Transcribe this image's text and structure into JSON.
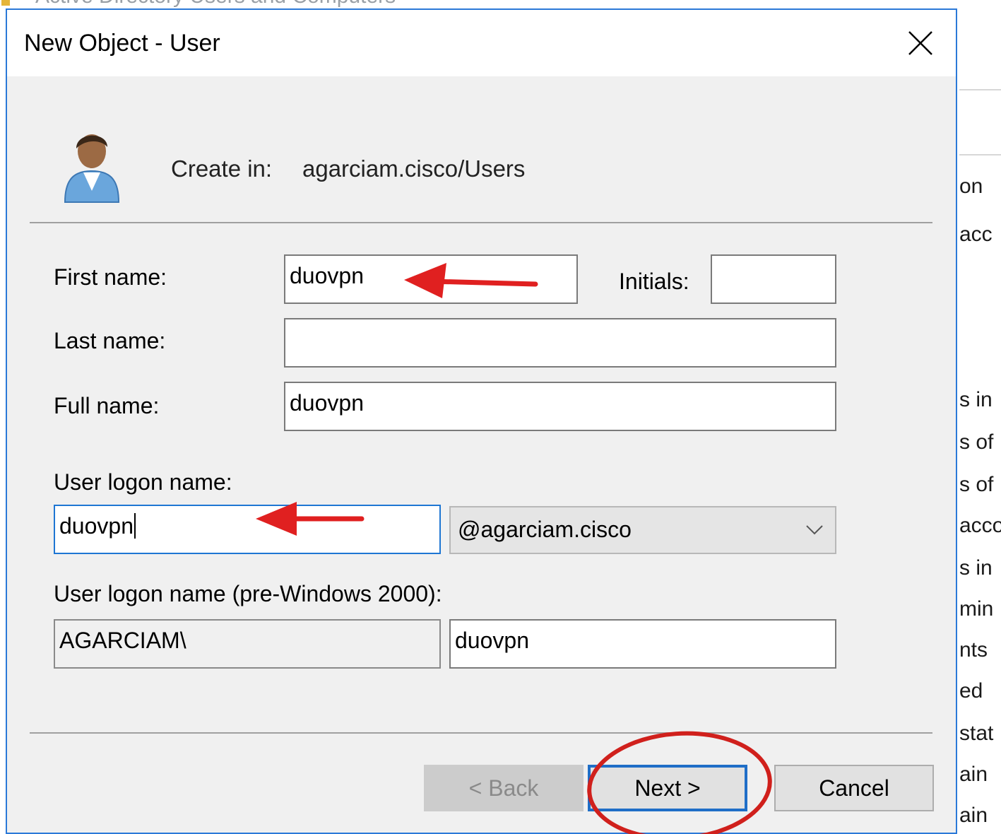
{
  "background_window": {
    "title": "Active Directory Users and Computers",
    "fragments": [
      {
        "text": "on"
      },
      {
        "text": "acc"
      },
      {
        "text": "s in"
      },
      {
        "text": "s of"
      },
      {
        "text": "s of"
      },
      {
        "text": "acco"
      },
      {
        "text": "s in"
      },
      {
        "text": "min"
      },
      {
        "text": "nts"
      },
      {
        "text": "ed"
      },
      {
        "text": "stat"
      },
      {
        "text": "ain"
      },
      {
        "text": "ain"
      }
    ]
  },
  "dialog": {
    "title": "New Object - User",
    "close_icon": "close-icon",
    "avatar_icon": "user-avatar-icon",
    "create_in_label": "Create in:",
    "create_in_value": "agarciam.cisco/Users",
    "form": {
      "first_name_label": "First name:",
      "first_name_value": "duovpn",
      "initials_label": "Initials:",
      "initials_value": "",
      "last_name_label": "Last name:",
      "last_name_value": "",
      "full_name_label": "Full name:",
      "full_name_value": "duovpn",
      "logon_name_label": "User logon name:",
      "logon_name_value": "duovpn",
      "domain_suffix_value": "@agarciam.cisco",
      "pre2000_label": "User logon name (pre-Windows 2000):",
      "pre2000_domain_value": "AGARCIAM\\",
      "pre2000_name_value": "duovpn"
    },
    "buttons": {
      "back_label": "< Back",
      "next_label": "Next >",
      "cancel_label": "Cancel"
    }
  },
  "annotations": {
    "arrow_color": "#e02020",
    "circle_color": "#d0201c"
  }
}
